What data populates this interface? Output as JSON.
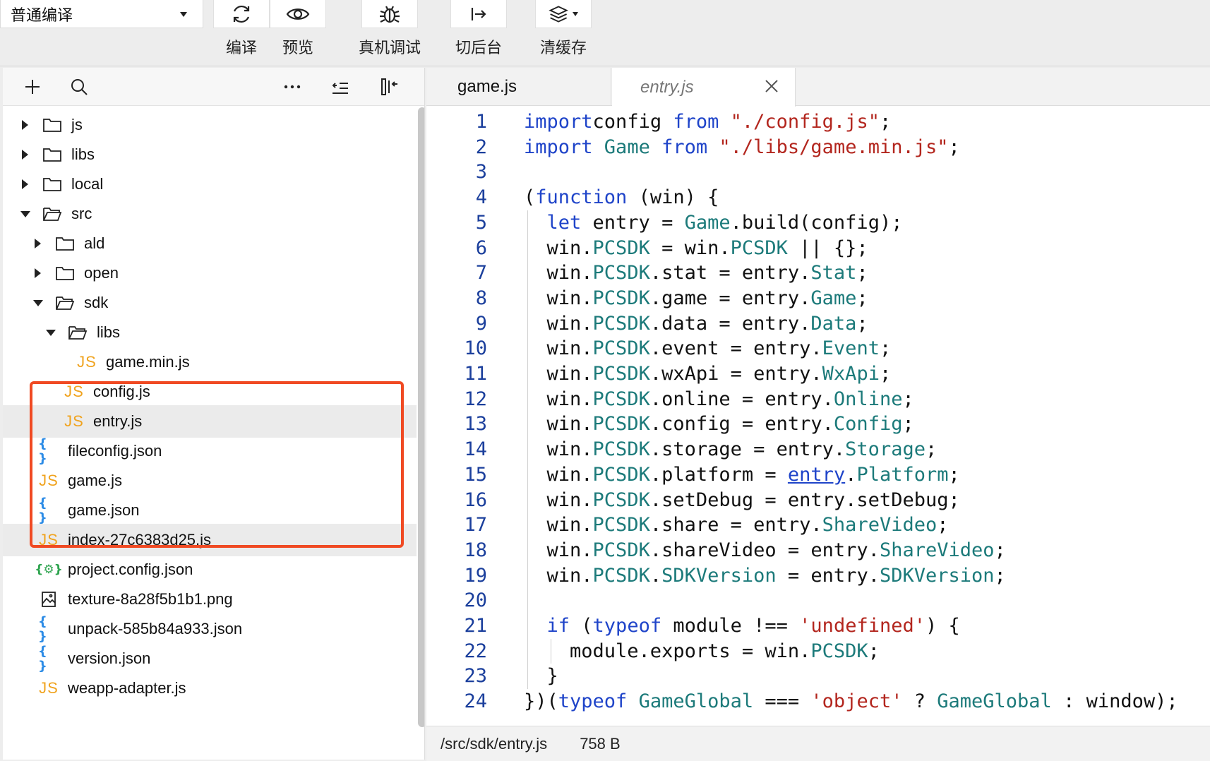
{
  "toolbar": {
    "mode": "普通编译",
    "tools": [
      {
        "icon": "refresh-icon",
        "label": "编译"
      },
      {
        "icon": "eye-icon",
        "label": "预览"
      },
      {
        "icon": "bug-icon",
        "label": "真机调试"
      },
      {
        "icon": "switch-background-icon",
        "label": "切后台"
      },
      {
        "icon": "layers-icon",
        "label": "清缓存"
      }
    ]
  },
  "sidebar": {
    "actions": [
      "add-icon",
      "search-icon",
      "more-icon",
      "outdent-icon",
      "collapse-panel-icon"
    ],
    "tree": [
      {
        "label": "js",
        "type": "folder",
        "state": "collapsed",
        "depth": 0
      },
      {
        "label": "libs",
        "type": "folder",
        "state": "collapsed",
        "depth": 0
      },
      {
        "label": "local",
        "type": "folder",
        "state": "collapsed",
        "depth": 0
      },
      {
        "label": "src",
        "type": "folder",
        "state": "expanded",
        "depth": 0
      },
      {
        "label": "ald",
        "type": "folder",
        "state": "collapsed",
        "depth": 1
      },
      {
        "label": "open",
        "type": "folder",
        "state": "collapsed",
        "depth": 1
      },
      {
        "label": "sdk",
        "type": "folder",
        "state": "expanded",
        "depth": 1
      },
      {
        "label": "libs",
        "type": "folder",
        "state": "expanded",
        "depth": 2
      },
      {
        "label": "game.min.js",
        "type": "js",
        "depth": 3
      },
      {
        "label": "config.js",
        "type": "js",
        "depth": 2
      },
      {
        "label": "entry.js",
        "type": "js",
        "depth": 2,
        "selected": true
      },
      {
        "label": "fileconfig.json",
        "type": "json",
        "depth": 0
      },
      {
        "label": "game.js",
        "type": "js",
        "depth": 0
      },
      {
        "label": "game.json",
        "type": "json",
        "depth": 0
      },
      {
        "label": "index-27c6383d25.js",
        "type": "js",
        "depth": 0,
        "hover": true
      },
      {
        "label": "project.config.json",
        "type": "project",
        "depth": 0
      },
      {
        "label": "texture-8a28f5b1b1.png",
        "type": "image",
        "depth": 0
      },
      {
        "label": "unpack-585b84a933.json",
        "type": "json",
        "depth": 0
      },
      {
        "label": "version.json",
        "type": "json",
        "depth": 0
      },
      {
        "label": "weapp-adapter.js",
        "type": "js",
        "depth": 0
      }
    ],
    "js_badge": "JS",
    "json_badge": "{ }",
    "project_badge": "{⚙}"
  },
  "editor": {
    "tabs": [
      {
        "label": "game.js",
        "active": false
      },
      {
        "label": "entry.js",
        "active": true
      }
    ],
    "lines": [
      [
        [
          "kw",
          "import"
        ],
        [
          "",
          "config "
        ],
        [
          "kw",
          "from"
        ],
        [
          "str",
          " \"./config.js\""
        ],
        [
          "",
          ";"
        ]
      ],
      [
        [
          "kw",
          "import"
        ],
        [
          "cls",
          " Game "
        ],
        [
          "kw",
          "from"
        ],
        [
          "str",
          " \"./libs/game.min.js\""
        ],
        [
          "",
          ";"
        ]
      ],
      [],
      [
        [
          "",
          "("
        ],
        [
          "kw",
          "function"
        ],
        [
          "",
          "",
          " (win) {"
        ]
      ],
      [
        [
          "",
          ""
        ],
        [
          "kw",
          "  let"
        ],
        [
          "",
          " entry = "
        ],
        [
          "cls",
          "Game"
        ],
        [
          "",
          ".build(config);"
        ]
      ],
      [
        [
          "",
          "  win."
        ],
        [
          "cls",
          "PCSDK"
        ],
        [
          "",
          " = win."
        ],
        [
          "cls",
          "PCSDK"
        ],
        [
          "",
          " || {};"
        ]
      ],
      [
        [
          "",
          "  win."
        ],
        [
          "cls",
          "PCSDK"
        ],
        [
          "",
          ".stat = entry."
        ],
        [
          "cls",
          "Stat"
        ],
        [
          "",
          ";"
        ]
      ],
      [
        [
          "",
          "  win."
        ],
        [
          "cls",
          "PCSDK"
        ],
        [
          "",
          ".game = entry."
        ],
        [
          "cls",
          "Game"
        ],
        [
          "",
          ";"
        ]
      ],
      [
        [
          "",
          "  win."
        ],
        [
          "cls",
          "PCSDK"
        ],
        [
          "",
          ".data = entry."
        ],
        [
          "cls",
          "Data"
        ],
        [
          "",
          ";"
        ]
      ],
      [
        [
          "",
          "  win."
        ],
        [
          "cls",
          "PCSDK"
        ],
        [
          "",
          ".event = entry."
        ],
        [
          "cls",
          "Event"
        ],
        [
          "",
          ";"
        ]
      ],
      [
        [
          "",
          "  win."
        ],
        [
          "cls",
          "PCSDK"
        ],
        [
          "",
          ".wxApi = entry."
        ],
        [
          "cls",
          "WxApi"
        ],
        [
          "",
          ";"
        ]
      ],
      [
        [
          "",
          "  win."
        ],
        [
          "cls",
          "PCSDK"
        ],
        [
          "",
          ".online = entry."
        ],
        [
          "cls",
          "Online"
        ],
        [
          "",
          ";"
        ]
      ],
      [
        [
          "",
          "  win."
        ],
        [
          "cls",
          "PCSDK"
        ],
        [
          "",
          ".config = entry."
        ],
        [
          "cls",
          "Config"
        ],
        [
          "",
          ";"
        ]
      ],
      [
        [
          "",
          "  win."
        ],
        [
          "cls",
          "PCSDK"
        ],
        [
          "",
          ".storage = entry."
        ],
        [
          "cls",
          "Storage"
        ],
        [
          "",
          ";"
        ]
      ],
      [
        [
          "",
          "  win."
        ],
        [
          "cls",
          "PCSDK"
        ],
        [
          "",
          ".platform = "
        ],
        [
          "lnk",
          "entry"
        ],
        [
          "",
          "."
        ],
        [
          "cls",
          "Platform"
        ],
        [
          "",
          ";"
        ]
      ],
      [
        [
          "",
          "  win."
        ],
        [
          "cls",
          "PCSDK"
        ],
        [
          "",
          ".setDebug = entry.setDebug;"
        ]
      ],
      [
        [
          "",
          "  win."
        ],
        [
          "cls",
          "PCSDK"
        ],
        [
          "",
          ".share = entry."
        ],
        [
          "cls",
          "ShareVideo"
        ],
        [
          "",
          ";"
        ]
      ],
      [
        [
          "",
          "  win."
        ],
        [
          "cls",
          "PCSDK"
        ],
        [
          "",
          ".shareVideo = entry."
        ],
        [
          "cls",
          "ShareVideo"
        ],
        [
          "",
          ";"
        ]
      ],
      [
        [
          "",
          "  win."
        ],
        [
          "cls",
          "PCSDK"
        ],
        [
          "",
          "."
        ],
        [
          "cls",
          "SDKVersion"
        ],
        [
          "",
          " = entry."
        ],
        [
          "cls",
          "SDKVersion"
        ],
        [
          "",
          ";"
        ]
      ],
      [],
      [
        [
          "kw",
          "  if"
        ],
        [
          "",
          " ("
        ],
        [
          "kw",
          "typeof"
        ],
        [
          "",
          " module !== "
        ],
        [
          "str",
          "'undefined'"
        ],
        [
          "",
          ") {"
        ]
      ],
      [
        [
          "",
          "    module.exports = win."
        ],
        [
          "cls",
          "PCSDK"
        ],
        [
          "",
          ";"
        ]
      ],
      [
        [
          "",
          "  }"
        ]
      ],
      [
        [
          "",
          "})("
        ],
        [
          "kw",
          "typeof"
        ],
        [
          "cls",
          " GameGlobal"
        ],
        [
          "",
          " === "
        ],
        [
          "str",
          "'object'"
        ],
        [
          "",
          " ? "
        ],
        [
          "cls",
          "GameGlobal"
        ],
        [
          "",
          " : window);"
        ]
      ]
    ]
  },
  "status": {
    "path": "/src/sdk/entry.js",
    "size": "758 B"
  }
}
